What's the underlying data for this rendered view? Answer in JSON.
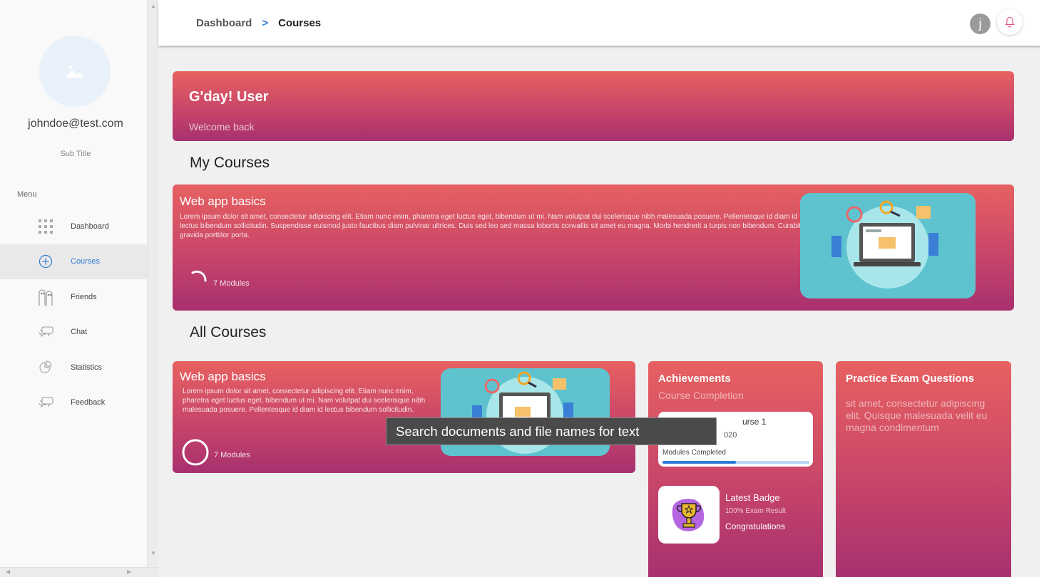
{
  "sidebar": {
    "email": "johndoe@test.com",
    "subtitle": "Sub Title",
    "menu_label": "Menu",
    "items": [
      {
        "label": "Dashboard",
        "icon": "grid-icon",
        "active": false
      },
      {
        "label": "Courses",
        "icon": "plus-circle-icon",
        "active": true
      },
      {
        "label": "Friends",
        "icon": "friends-icon",
        "active": false
      },
      {
        "label": "Chat",
        "icon": "chat-bubbles-icon",
        "active": false
      },
      {
        "label": "Statistics",
        "icon": "pie-chart-icon",
        "active": false
      },
      {
        "label": "Feedback",
        "icon": "feedback-bubbles-icon",
        "active": false
      }
    ]
  },
  "header": {
    "breadcrumb_root": "Dashboard",
    "breadcrumb_separator": ">",
    "breadcrumb_current": "Courses",
    "user_initial": "j"
  },
  "welcome": {
    "title": "G'day! User",
    "subtitle": "Welcome back"
  },
  "my_courses": {
    "heading": "My Courses",
    "course": {
      "title": "Web app basics",
      "description": "Lorem ipsum dolor sit amet, consectetur adipiscing elit. Etiam nunc enim, pharetra eget luctus eget, bibendum ut mi. Nam volutpat dui scelerisque nibh malesuada posuere. Pellentesque id diam id lectus bibendum sollicitudin. Suspendisse euismod justo faucibus diam pulvinar ultrices. Duis sed leo sed massa lobortis convallis sit amet eu magna. Morbi hendrerit a turpis non bibendum. Curabitur gravida porttitor porta.",
      "modules": "7 Modules"
    }
  },
  "all_courses": {
    "heading": "All Courses",
    "course": {
      "title": "Web app basics",
      "description": "Lorem ipsum dolor sit amet, consectetur adipiscing elit. Etiam nunc enim, pharetra eget luctus eget, bibendum ut mi. Nam volutpat dui scelerisque nibh malesuada posuere. Pellentesque id diam id lectus bibendum sollicitudin.",
      "modules": "7 Modules"
    }
  },
  "achievements": {
    "title": "Achievements",
    "subtitle": "Course Completion",
    "course_name": "urse 1",
    "course_date": "020",
    "progress_label": "Modules Completed",
    "progress_fraction": 0.5,
    "badge_title": "Latest Badge",
    "badge_detail": "100% Exam Result",
    "badge_message": "Congratulations"
  },
  "practice": {
    "title": "Practice Exam Questions",
    "text": "sit amet, consectetur adipiscing elit. Quisque malesuada velit eu magna condimentum"
  },
  "tooltip": {
    "text": "Search documents and file names for text"
  },
  "colors": {
    "card_gradient_top": "#e76161",
    "card_gradient_bottom": "#a8306f",
    "accent_blue": "#2e7bd6",
    "illustration_teal": "#5ec3cf"
  }
}
